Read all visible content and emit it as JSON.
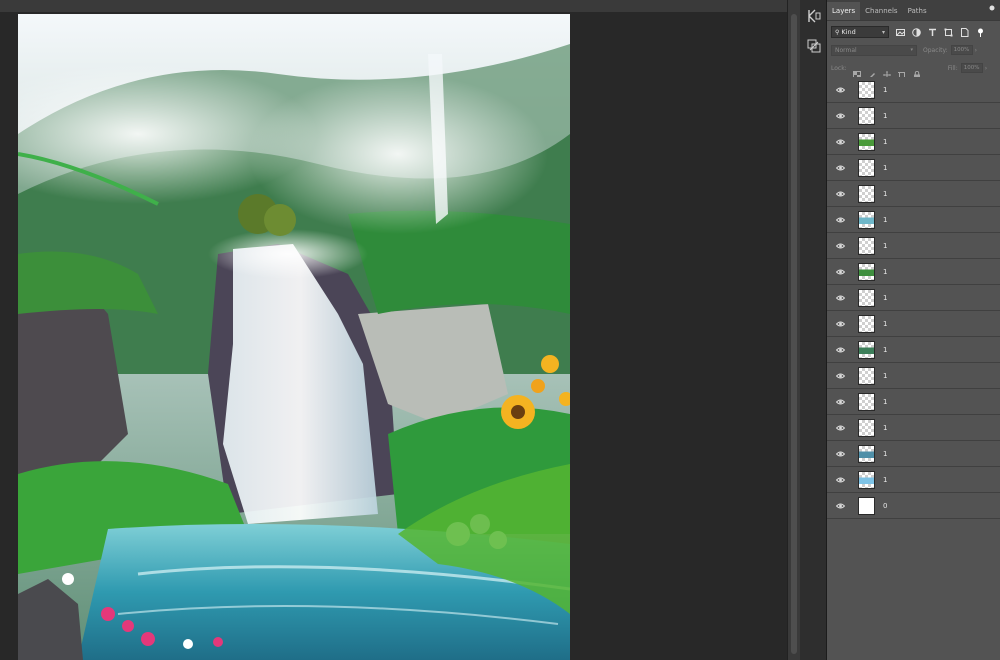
{
  "panel": {
    "tabs": [
      {
        "label": "Layers",
        "active": true
      },
      {
        "label": "Channels",
        "active": false
      },
      {
        "label": "Paths",
        "active": false
      }
    ],
    "filter": {
      "kind_label": "Kind",
      "icons": [
        "image-filter-icon",
        "adjustment-filter-icon",
        "type-filter-icon",
        "shape-filter-icon",
        "smart-object-filter-icon",
        "filter-toggle-icon"
      ]
    },
    "blend": {
      "mode": "Normal",
      "opacity_label": "Opacity:",
      "opacity_value": "100%"
    },
    "lock": {
      "label": "Lock:",
      "fill_label": "Fill:",
      "fill_value": "100%",
      "icons": [
        "lock-transparent-icon",
        "lock-image-icon",
        "lock-position-icon",
        "lock-artboard-icon",
        "lock-all-icon"
      ]
    },
    "layers": [
      {
        "name": "1",
        "thumb": "checker",
        "thumb_tint": ""
      },
      {
        "name": "1",
        "thumb": "checker",
        "thumb_tint": ""
      },
      {
        "name": "1",
        "thumb": "checker",
        "thumb_tint": "#4a9a3a"
      },
      {
        "name": "1",
        "thumb": "checker",
        "thumb_tint": ""
      },
      {
        "name": "1",
        "thumb": "checker",
        "thumb_tint": ""
      },
      {
        "name": "1",
        "thumb": "checker",
        "thumb_tint": "#6fb7c9"
      },
      {
        "name": "1",
        "thumb": "checker",
        "thumb_tint": ""
      },
      {
        "name": "1",
        "thumb": "checker",
        "thumb_tint": "#3f8f3f"
      },
      {
        "name": "1",
        "thumb": "checker",
        "thumb_tint": ""
      },
      {
        "name": "1",
        "thumb": "checker",
        "thumb_tint": ""
      },
      {
        "name": "1",
        "thumb": "checker",
        "thumb_tint": "#3d7f5a"
      },
      {
        "name": "1",
        "thumb": "checker",
        "thumb_tint": ""
      },
      {
        "name": "1",
        "thumb": "checker",
        "thumb_tint": ""
      },
      {
        "name": "1",
        "thumb": "checker",
        "thumb_tint": ""
      },
      {
        "name": "1",
        "thumb": "checker",
        "thumb_tint": "#4f8fa8"
      },
      {
        "name": "1",
        "thumb": "checker",
        "thumb_tint": "#7ec3e6"
      },
      {
        "name": "0",
        "thumb": "white",
        "thumb_tint": ""
      }
    ]
  },
  "colors": {
    "panel_bg": "#535353",
    "workspace_bg": "#282828",
    "tab_active": "#f2f2f2"
  }
}
